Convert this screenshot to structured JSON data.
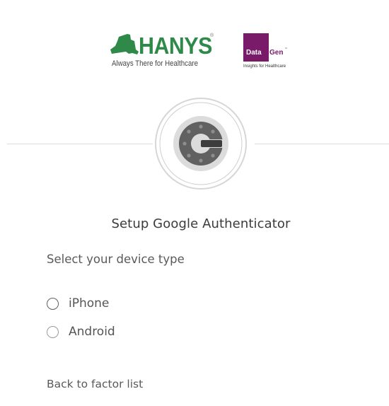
{
  "branding": {
    "hanys_name": "HANYS",
    "hanys_reg_mark": "®",
    "hanys_tagline": "Always There for Healthcare",
    "datagen_data": "Data",
    "datagen_gen": "Gen",
    "datagen_tm": "™",
    "datagen_tagline": "Insights for Healthcare",
    "colors": {
      "hanys_green": "#2f8a4a",
      "datagen_purple": "#7a1b6a"
    }
  },
  "factor": {
    "icon": "google-authenticator-icon",
    "title": "Setup Google Authenticator"
  },
  "device_select": {
    "prompt": "Select your device type",
    "options": [
      {
        "label": "iPhone",
        "selected": false
      },
      {
        "label": "Android",
        "selected": false
      }
    ]
  },
  "navigation": {
    "back_label": "Back to factor list"
  }
}
